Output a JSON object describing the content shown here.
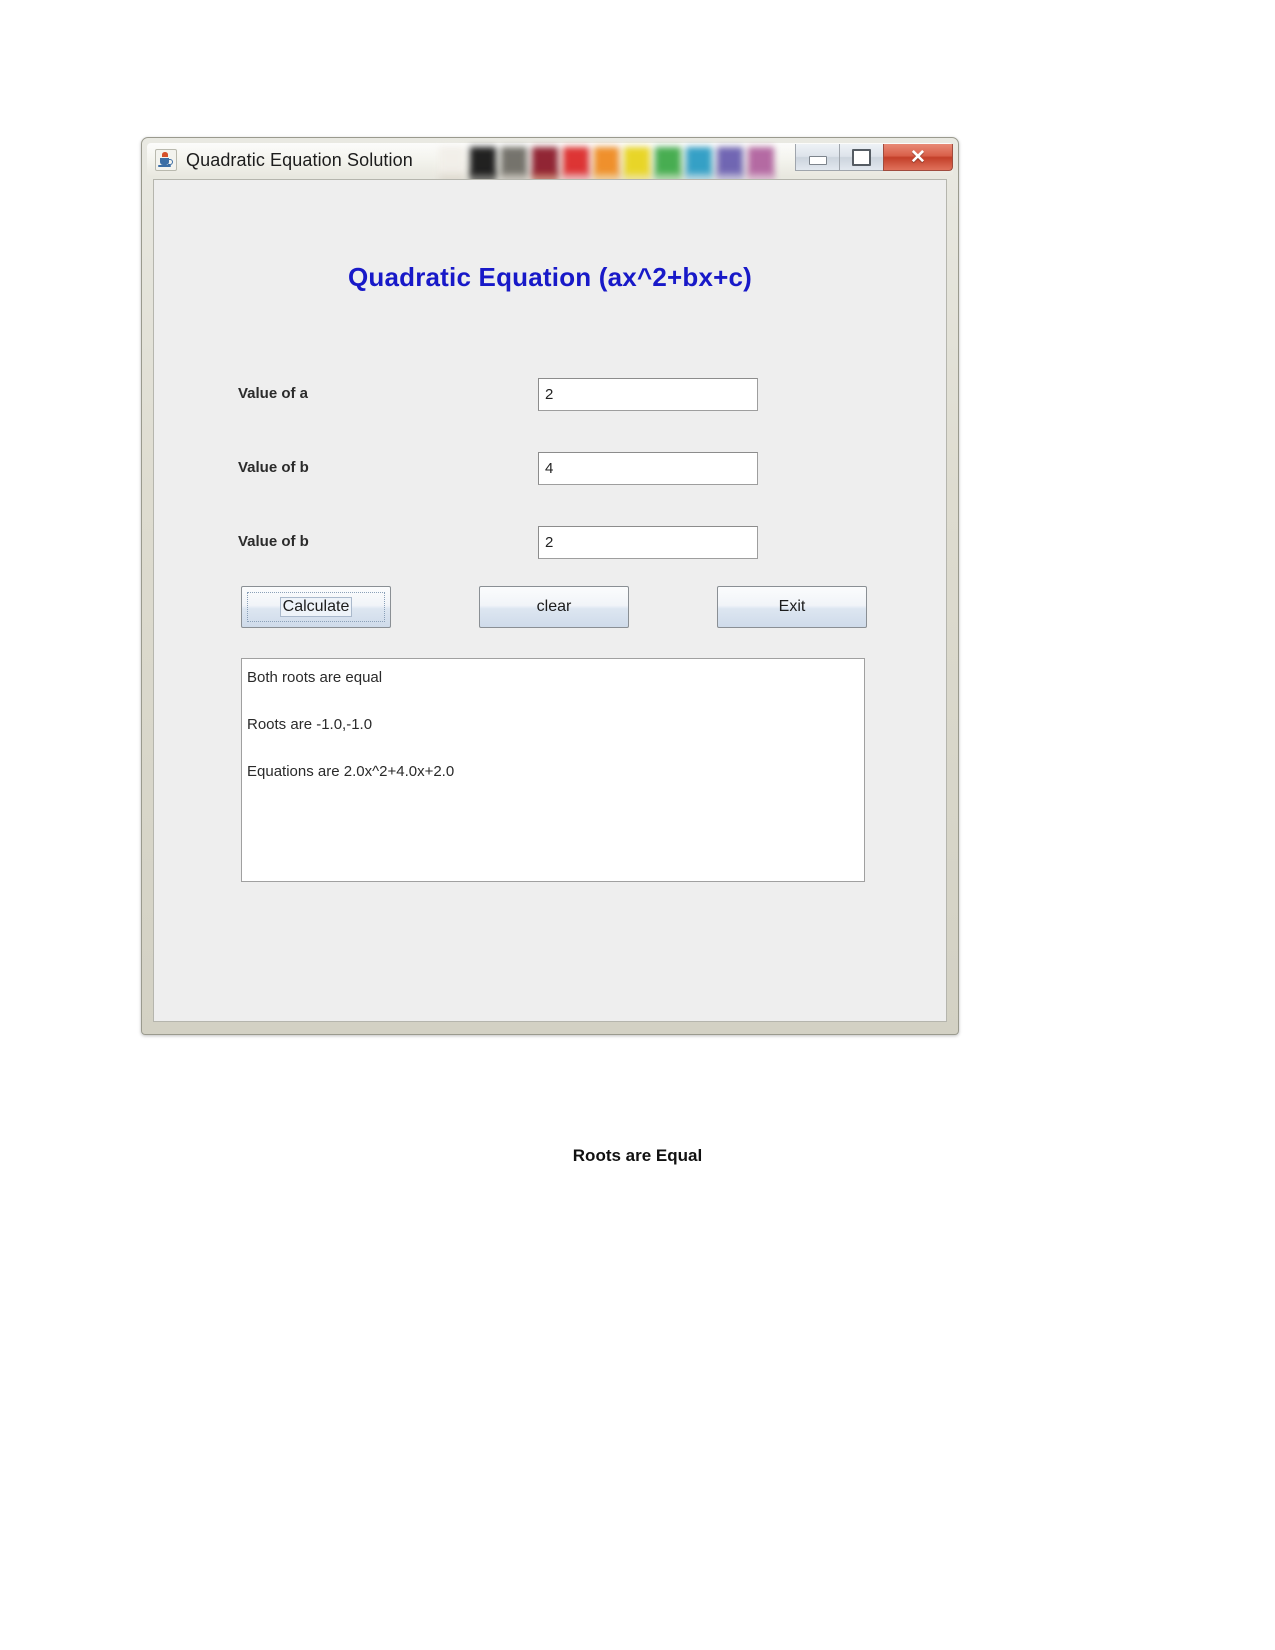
{
  "window": {
    "title": "Quadratic Equation Solution",
    "app_icon": "java-coffee-cup-icon",
    "controls": {
      "minimize": "minimize-icon",
      "maximize": "maximize-icon",
      "close_label": "✕"
    },
    "palette_colors": [
      "#f2efe9",
      "#161616",
      "#6f6d66",
      "#8c1b2b",
      "#dc2b2b",
      "#ef8b22",
      "#e8d41e",
      "#3faa49",
      "#2b9cc4",
      "#6a5fb0",
      "#b1639f"
    ],
    "palette_colors_row2": [
      "#d8d2c6",
      "#3a3a38",
      "#b9b3aa",
      "#b7543f",
      "#f0a6ae",
      "#f4c27a",
      "#f0e277",
      "#9ed39b",
      "#a8d3e4",
      "#b8b3d8",
      "#d6aecb"
    ]
  },
  "form": {
    "heading": "Quadratic Equation (ax^2+bx+c)",
    "fields": [
      {
        "label": "Value of a",
        "value": "2"
      },
      {
        "label": "Value of b",
        "value": "4"
      },
      {
        "label": "Value of b",
        "value": "2"
      }
    ],
    "buttons": [
      {
        "label": "Calculate",
        "focused": true
      },
      {
        "label": "clear",
        "focused": false
      },
      {
        "label": "Exit",
        "focused": false
      }
    ],
    "results": [
      "Both roots are equal",
      "Roots are -1.0,-1.0",
      "Equations are 2.0x^2+4.0x+2.0"
    ]
  },
  "caption": "Roots are Equal",
  "colors": {
    "heading": "#1819c8",
    "close_button": "#c33f29",
    "client_background": "#eeeeee"
  }
}
